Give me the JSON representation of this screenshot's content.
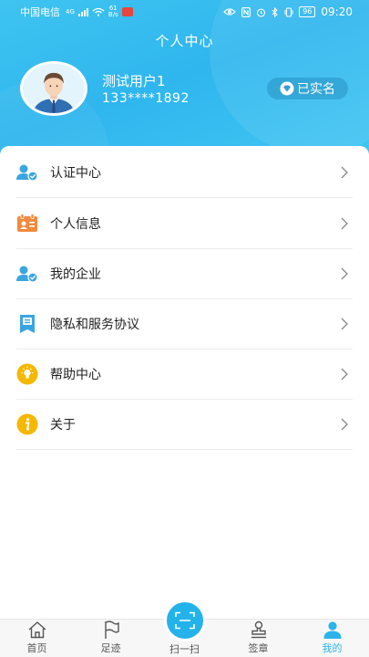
{
  "status_bar": {
    "carrier": "中国电信",
    "network_small": "4G",
    "speed_value": "61",
    "speed_unit": "B/s",
    "battery": "96",
    "time": "09:20"
  },
  "header": {
    "title": "个人中心"
  },
  "user": {
    "name": "测试用户1",
    "phone": "133****1892",
    "verified_label": "已实名"
  },
  "menu": [
    {
      "label": "认证中心",
      "icon": "user-verify-icon"
    },
    {
      "label": "个人信息",
      "icon": "id-card-icon"
    },
    {
      "label": "我的企业",
      "icon": "enterprise-user-icon"
    },
    {
      "label": "隐私和服务协议",
      "icon": "document-icon"
    },
    {
      "label": "帮助中心",
      "icon": "lightbulb-icon"
    },
    {
      "label": "关于",
      "icon": "info-icon"
    }
  ],
  "tabs": [
    {
      "label": "首页",
      "icon": "home-icon"
    },
    {
      "label": "足迹",
      "icon": "flag-icon"
    },
    {
      "label": "扫一扫",
      "icon": "scan-icon"
    },
    {
      "label": "签章",
      "icon": "stamp-icon"
    },
    {
      "label": "我的",
      "icon": "profile-icon"
    }
  ],
  "colors": {
    "accent": "#2bb3ea",
    "header_bg": "#3cc0f0",
    "text_primary": "#222222",
    "icon_orange": "#f08a3c",
    "icon_yellow": "#f5b800"
  }
}
